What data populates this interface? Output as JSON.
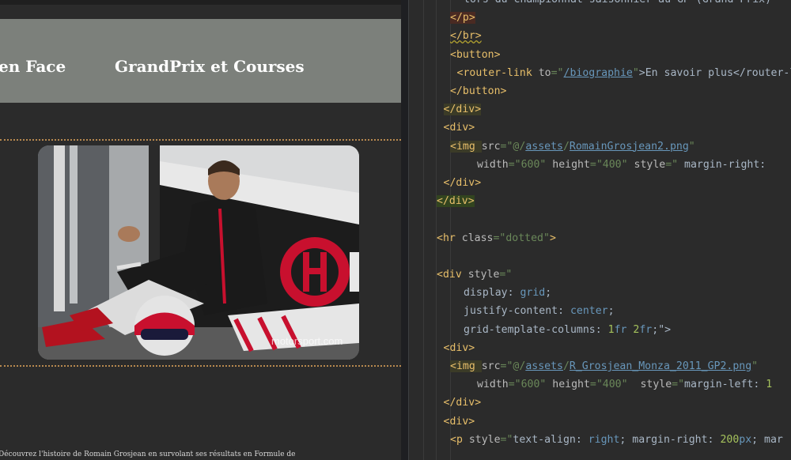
{
  "preview": {
    "nav_items": [
      "en Face",
      "GrandPrix et Courses"
    ],
    "photo_watermark": "motorsport.com",
    "bottom_text": "Découvrez l'histoire de Romain Grosjean en survolant ses résultats en Formule de"
  },
  "editor": {
    "lines": [
      {
        "indent": 6,
        "segments": [
          {
            "t": "lors du championnat saisonnier au GP (Grand-Prix) ",
            "c": "t-txt"
          }
        ]
      },
      {
        "indent": 4,
        "segments": [
          {
            "t": "</p>",
            "c": "t-tag hl-red"
          }
        ]
      },
      {
        "indent": 4,
        "segments": [
          {
            "t": "</br>",
            "c": "t-tag squiggle"
          }
        ]
      },
      {
        "indent": 4,
        "segments": [
          {
            "t": "<button>",
            "c": "t-tag"
          }
        ]
      },
      {
        "indent": 5,
        "segments": [
          {
            "t": "<router-link ",
            "c": "t-tag"
          },
          {
            "t": "to",
            "c": "t-attr"
          },
          {
            "t": "=\"",
            "c": "t-str"
          },
          {
            "t": "/biographie",
            "c": "t-link"
          },
          {
            "t": "\"",
            "c": "t-str"
          },
          {
            "t": ">En savoir plus</router-link>",
            "c": "t-txt"
          }
        ]
      },
      {
        "indent": 4,
        "segments": [
          {
            "t": "</button>",
            "c": "t-tag"
          }
        ]
      },
      {
        "indent": 3,
        "segments": [
          {
            "t": "</div>",
            "c": "t-tag hl"
          }
        ]
      },
      {
        "indent": 3,
        "segments": [
          {
            "t": "<div>",
            "c": "t-tag"
          }
        ]
      },
      {
        "indent": 4,
        "segments": [
          {
            "t": "<img ",
            "c": "t-tag hl"
          },
          {
            "t": "src",
            "c": "t-attr"
          },
          {
            "t": "=\"",
            "c": "t-str"
          },
          {
            "t": "@/",
            "c": "t-str"
          },
          {
            "t": "assets",
            "c": "t-link"
          },
          {
            "t": "/",
            "c": "t-str"
          },
          {
            "t": "RomainGrosjean2.png",
            "c": "t-link"
          },
          {
            "t": "\"",
            "c": "t-str"
          }
        ]
      },
      {
        "indent": 8,
        "segments": [
          {
            "t": "width",
            "c": "t-attr"
          },
          {
            "t": "=\"600\"",
            "c": "t-str"
          },
          {
            "t": " height",
            "c": "t-attr"
          },
          {
            "t": "=\"400\"",
            "c": "t-str"
          },
          {
            "t": " style",
            "c": "t-attr"
          },
          {
            "t": "=\" ",
            "c": "t-str"
          },
          {
            "t": "margin-right: ",
            "c": "t-txt"
          }
        ]
      },
      {
        "indent": 3,
        "segments": [
          {
            "t": "</div>",
            "c": "t-tag"
          }
        ]
      },
      {
        "indent": 2,
        "segments": [
          {
            "t": "</div>",
            "c": "t-tag hl2"
          }
        ]
      },
      {
        "indent": 0,
        "segments": []
      },
      {
        "indent": 2,
        "segments": [
          {
            "t": "<hr ",
            "c": "t-tag"
          },
          {
            "t": "class",
            "c": "t-attr"
          },
          {
            "t": "=\"dotted\"",
            "c": "t-str"
          },
          {
            "t": ">",
            "c": "t-tag"
          }
        ]
      },
      {
        "indent": 0,
        "segments": []
      },
      {
        "indent": 2,
        "segments": [
          {
            "t": "<div ",
            "c": "t-tag"
          },
          {
            "t": "style",
            "c": "t-attr"
          },
          {
            "t": "=\"",
            "c": "t-str"
          }
        ]
      },
      {
        "indent": 6,
        "segments": [
          {
            "t": "display: ",
            "c": "t-txt"
          },
          {
            "t": "grid",
            "c": "t-kw2"
          },
          {
            "t": ";",
            "c": "t-txt"
          }
        ]
      },
      {
        "indent": 6,
        "segments": [
          {
            "t": "justify-content: ",
            "c": "t-txt"
          },
          {
            "t": "center",
            "c": "t-kw2"
          },
          {
            "t": ";",
            "c": "t-txt"
          }
        ]
      },
      {
        "indent": 6,
        "segments": [
          {
            "t": "grid-template-columns: ",
            "c": "t-txt"
          },
          {
            "t": "1",
            "c": "t-lime"
          },
          {
            "t": "fr ",
            "c": "t-kw2"
          },
          {
            "t": "2",
            "c": "t-lime"
          },
          {
            "t": "fr",
            "c": "t-kw2"
          },
          {
            "t": ";\">",
            "c": "t-txt"
          }
        ]
      },
      {
        "indent": 3,
        "segments": [
          {
            "t": "<div>",
            "c": "t-tag"
          }
        ]
      },
      {
        "indent": 4,
        "segments": [
          {
            "t": "<img ",
            "c": "t-tag hl"
          },
          {
            "t": "src",
            "c": "t-attr"
          },
          {
            "t": "=\"",
            "c": "t-str"
          },
          {
            "t": "@/",
            "c": "t-str"
          },
          {
            "t": "assets",
            "c": "t-link"
          },
          {
            "t": "/",
            "c": "t-str"
          },
          {
            "t": "R_Grosjean_Monza_2011_GP2.png",
            "c": "t-link"
          },
          {
            "t": "\"",
            "c": "t-str"
          }
        ]
      },
      {
        "indent": 8,
        "segments": [
          {
            "t": "width",
            "c": "t-attr"
          },
          {
            "t": "=\"600\"",
            "c": "t-str"
          },
          {
            "t": " height",
            "c": "t-attr"
          },
          {
            "t": "=\"400\"",
            "c": "t-str"
          },
          {
            "t": "  style",
            "c": "t-attr"
          },
          {
            "t": "=\"",
            "c": "t-str"
          },
          {
            "t": "margin-left: ",
            "c": "t-txt"
          },
          {
            "t": "1",
            "c": "t-lime"
          }
        ]
      },
      {
        "indent": 3,
        "segments": [
          {
            "t": "</div>",
            "c": "t-tag"
          }
        ]
      },
      {
        "indent": 3,
        "segments": [
          {
            "t": "<div>",
            "c": "t-tag"
          }
        ]
      },
      {
        "indent": 4,
        "segments": [
          {
            "t": "<p ",
            "c": "t-tag"
          },
          {
            "t": "style",
            "c": "t-attr"
          },
          {
            "t": "=\"",
            "c": "t-str"
          },
          {
            "t": "text-align: ",
            "c": "t-txt"
          },
          {
            "t": "right",
            "c": "t-kw2"
          },
          {
            "t": "; margin-right: ",
            "c": "t-txt"
          },
          {
            "t": "200",
            "c": "t-lime"
          },
          {
            "t": "px",
            "c": "t-kw2"
          },
          {
            "t": "; mar",
            "c": "t-txt"
          }
        ]
      }
    ]
  }
}
